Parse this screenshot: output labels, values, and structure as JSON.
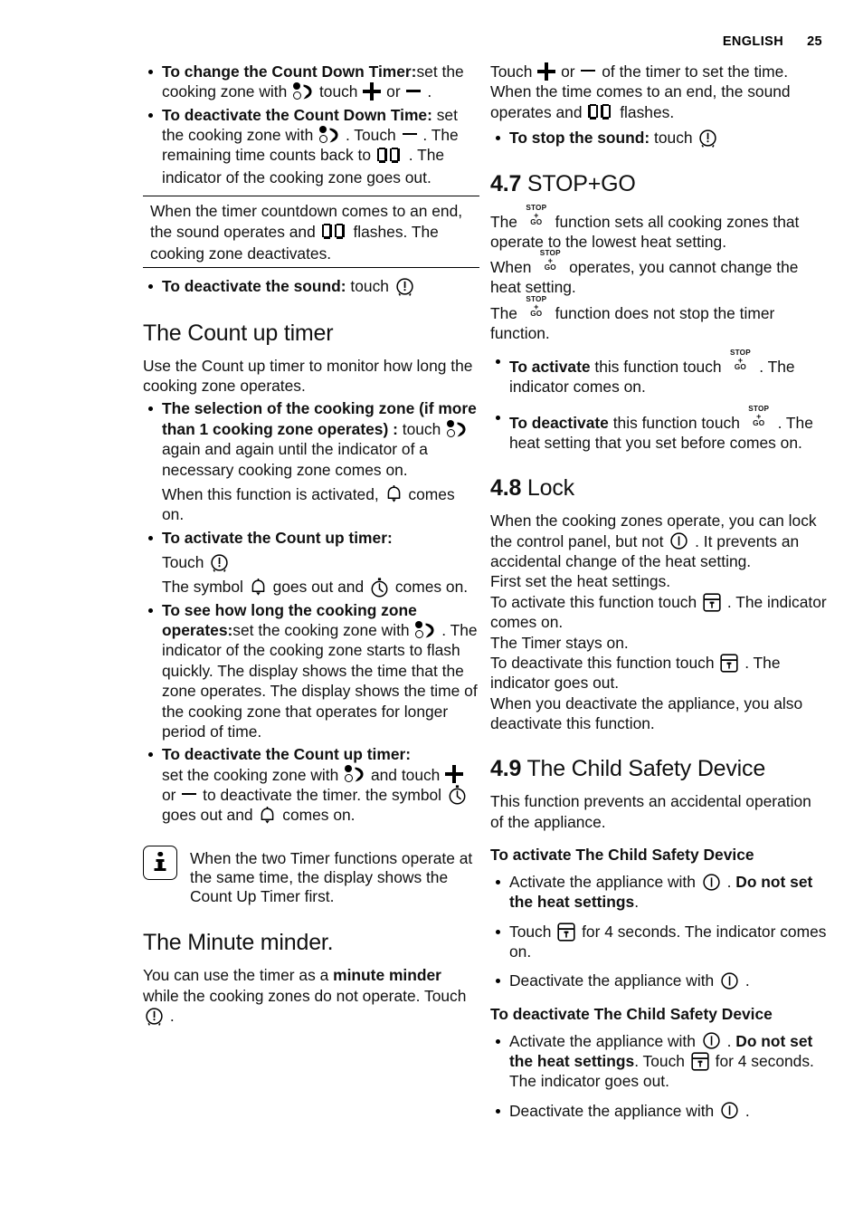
{
  "header": {
    "language": "ENGLISH",
    "page_number": "25"
  },
  "icons": {
    "zone": "cooking-zone-select-icon",
    "timer": "timer-icon",
    "bell": "bell-icon",
    "stopwatch": "stopwatch-icon",
    "plus": "plus-icon",
    "minus": "minus-icon",
    "power": "power-icon",
    "lock": "lock-icon",
    "segments": "seven-segment-00",
    "stopgo": "stop-plus-go-icon",
    "info": "info-icon"
  },
  "stopgo_icon": {
    "top": "STOP",
    "middle": "+",
    "bottom": "GO"
  },
  "left_column": {
    "bullets_top": [
      {
        "bold_lead": "To change the Count Down Timer:",
        "text_a": "set the cooking zone with",
        "text_b": "touch",
        "text_c": "or",
        "text_d": "."
      },
      {
        "bold_lead": "To deactivate the Count Down Time:",
        "text_a": "set the cooking zone with",
        "text_b": ". Touch",
        "text_c": ". The remaining time counts back to",
        "text_d": ". The indicator of the cooking zone goes out."
      }
    ],
    "note_box": {
      "text_a": "When the timer countdown comes to an end, the sound operates and",
      "text_b": "flashes. The cooking zone deactivates."
    },
    "deactivate_sound": {
      "bold_lead": "To deactivate the sound:",
      "text": "touch"
    },
    "count_up": {
      "heading": "The Count up timer",
      "intro": "Use the Count up timer to monitor how long the cooking zone operates.",
      "bullet_selection": {
        "bold_lead": "The selection of the cooking zone (if more than 1 cooking zone operates) :",
        "text_a": "touch",
        "text_b": "again and again until the indicator of a necessary cooking zone comes on.",
        "sub_a": "When this function is activated,",
        "sub_b": "comes on."
      },
      "bullet_activate": {
        "bold_lead": "To activate the Count up timer:",
        "sub_touch": "Touch",
        "sub_symbol_a": "The symbol",
        "sub_symbol_b": "goes out and",
        "sub_symbol_c": "comes on."
      },
      "bullet_see": {
        "bold_lead": "To see how long the cooking zone operates:",
        "text_a": "set the cooking zone with",
        "text_b": ". The indicator of the cooking zone starts to flash quickly. The display shows the time that the zone operates. The display shows the time of the cooking zone that operates for longer period of time."
      },
      "bullet_deactivate": {
        "bold_lead": "To deactivate the Count up timer:",
        "text_a": "set the cooking zone with",
        "text_b": "and touch",
        "text_c": "or",
        "text_d": "to deactivate the timer. the symbol",
        "text_e": "goes out and",
        "text_f": "comes on."
      }
    },
    "callout": {
      "text": "When the two Timer functions operate at the same time, the display shows the Count Up Timer first."
    },
    "minute_minder": {
      "heading": "The Minute minder.",
      "text_a": "You can use the timer as a",
      "bold_b": "minute minder",
      "text_c": "while the cooking zones do not operate. Touch",
      "text_d": "."
    }
  },
  "right_column": {
    "timer_set": {
      "text_a": "Touch",
      "text_b": "or",
      "text_c": "of the timer to set the time. When the time comes to an end, the sound operates and",
      "text_d": "flashes."
    },
    "stop_sound": {
      "bold_lead": "To stop the sound:",
      "text": "touch"
    },
    "section_47": {
      "number": "4.7",
      "title": "STOP+GO",
      "para_a1": "The",
      "para_a2": "function sets all cooking zones that operate to the lowest heat setting.",
      "para_b1": "When",
      "para_b2": "operates, you cannot change the heat setting.",
      "para_c1": "The",
      "para_c2": "function does not stop the timer function.",
      "bullet_activate": {
        "bold_lead": "To activate",
        "text_a": "this function touch",
        "text_b": ". The indicator comes on."
      },
      "bullet_deactivate": {
        "bold_lead": "To deactivate",
        "text_a": "this function touch",
        "text_b": ". The heat setting that you set before comes on."
      }
    },
    "section_48": {
      "number": "4.8",
      "title": "Lock",
      "para_a1": "When the cooking zones operate, you can lock the control panel, but not",
      "para_a2": ". It prevents an accidental change of the heat setting.",
      "para_b": "First set the heat settings.",
      "para_c1": "To activate this function touch",
      "para_c2": ". The indicator comes on.",
      "para_d": "The Timer stays on.",
      "para_e1": "To deactivate this function touch",
      "para_e2": ". The indicator goes out.",
      "para_f": "When you deactivate the appliance, you also deactivate this function."
    },
    "section_49": {
      "number": "4.9",
      "title": "The Child Safety Device",
      "intro": "This function prevents an accidental operation of the appliance.",
      "activate_heading": "To activate The Child Safety Device",
      "activate_bullets": [
        {
          "text_a": "Activate the appliance with",
          "text_b": ".",
          "bold_c": "Do not set the heat settings",
          "text_d": "."
        },
        {
          "text_a": "Touch",
          "text_b": "for 4 seconds. The indicator comes on."
        },
        {
          "text_a": "Deactivate the appliance with",
          "text_b": "."
        }
      ],
      "deactivate_heading": "To deactivate The Child Safety Device",
      "deactivate_bullets": [
        {
          "text_a": "Activate the appliance with",
          "text_b": ".",
          "bold_c": "Do not set the heat settings",
          "text_d": ". Touch",
          "text_e": "for 4 seconds. The indicator goes out."
        },
        {
          "text_a": "Deactivate the appliance with",
          "text_b": "."
        }
      ]
    }
  }
}
